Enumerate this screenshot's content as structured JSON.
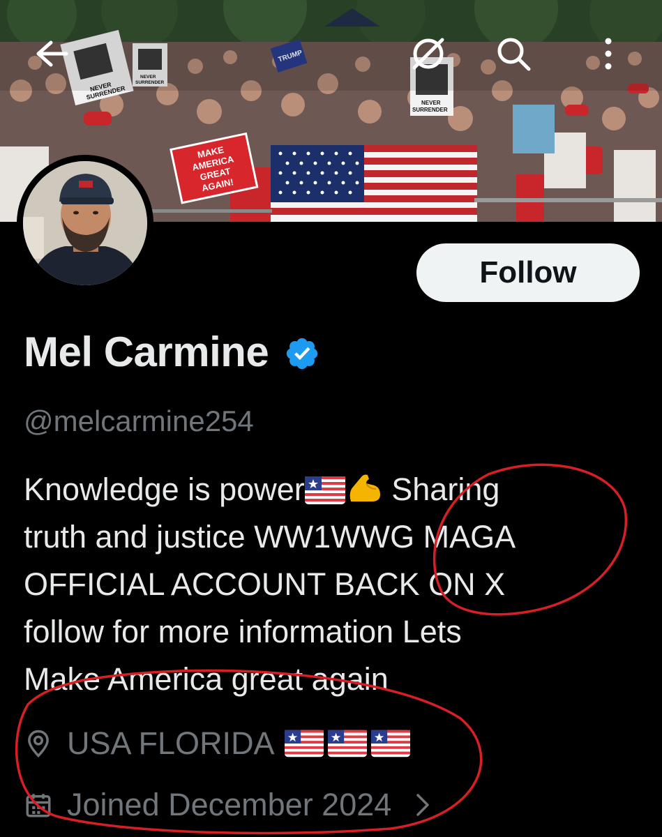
{
  "header": {
    "back_icon": "arrow-left-icon",
    "grok_icon": "grok-icon",
    "search_icon": "search-icon",
    "more_icon": "more-vertical-icon"
  },
  "banner": {
    "signs": [
      "NEVER SURRENDER",
      "NEVER SURRENDER",
      "NEVER SURRENDER",
      "MAKE AMERICA GREAT AGAIN!",
      "TRUMP 2024"
    ]
  },
  "profile": {
    "follow_label": "Follow",
    "display_name": "Mel Carmine",
    "verified_icon": "verified-badge-icon",
    "handle": "@melcarmine254",
    "bio_lines": [
      "Knowledge is power",
      "Sharing",
      "truth and justice WW1WWG MAGA",
      "OFFICIAL ACCOUNT  BACK ON X",
      "follow for more information  Lets",
      "Make America great again"
    ],
    "location": "USA FLORIDA",
    "joined": "Joined December 2024"
  },
  "colors": {
    "background": "#000000",
    "text_primary": "#e7e9ea",
    "text_secondary": "#71767b",
    "verified_blue": "#1d9bf0",
    "follow_bg": "#eff3f4",
    "annotation_red": "#d81f26"
  }
}
